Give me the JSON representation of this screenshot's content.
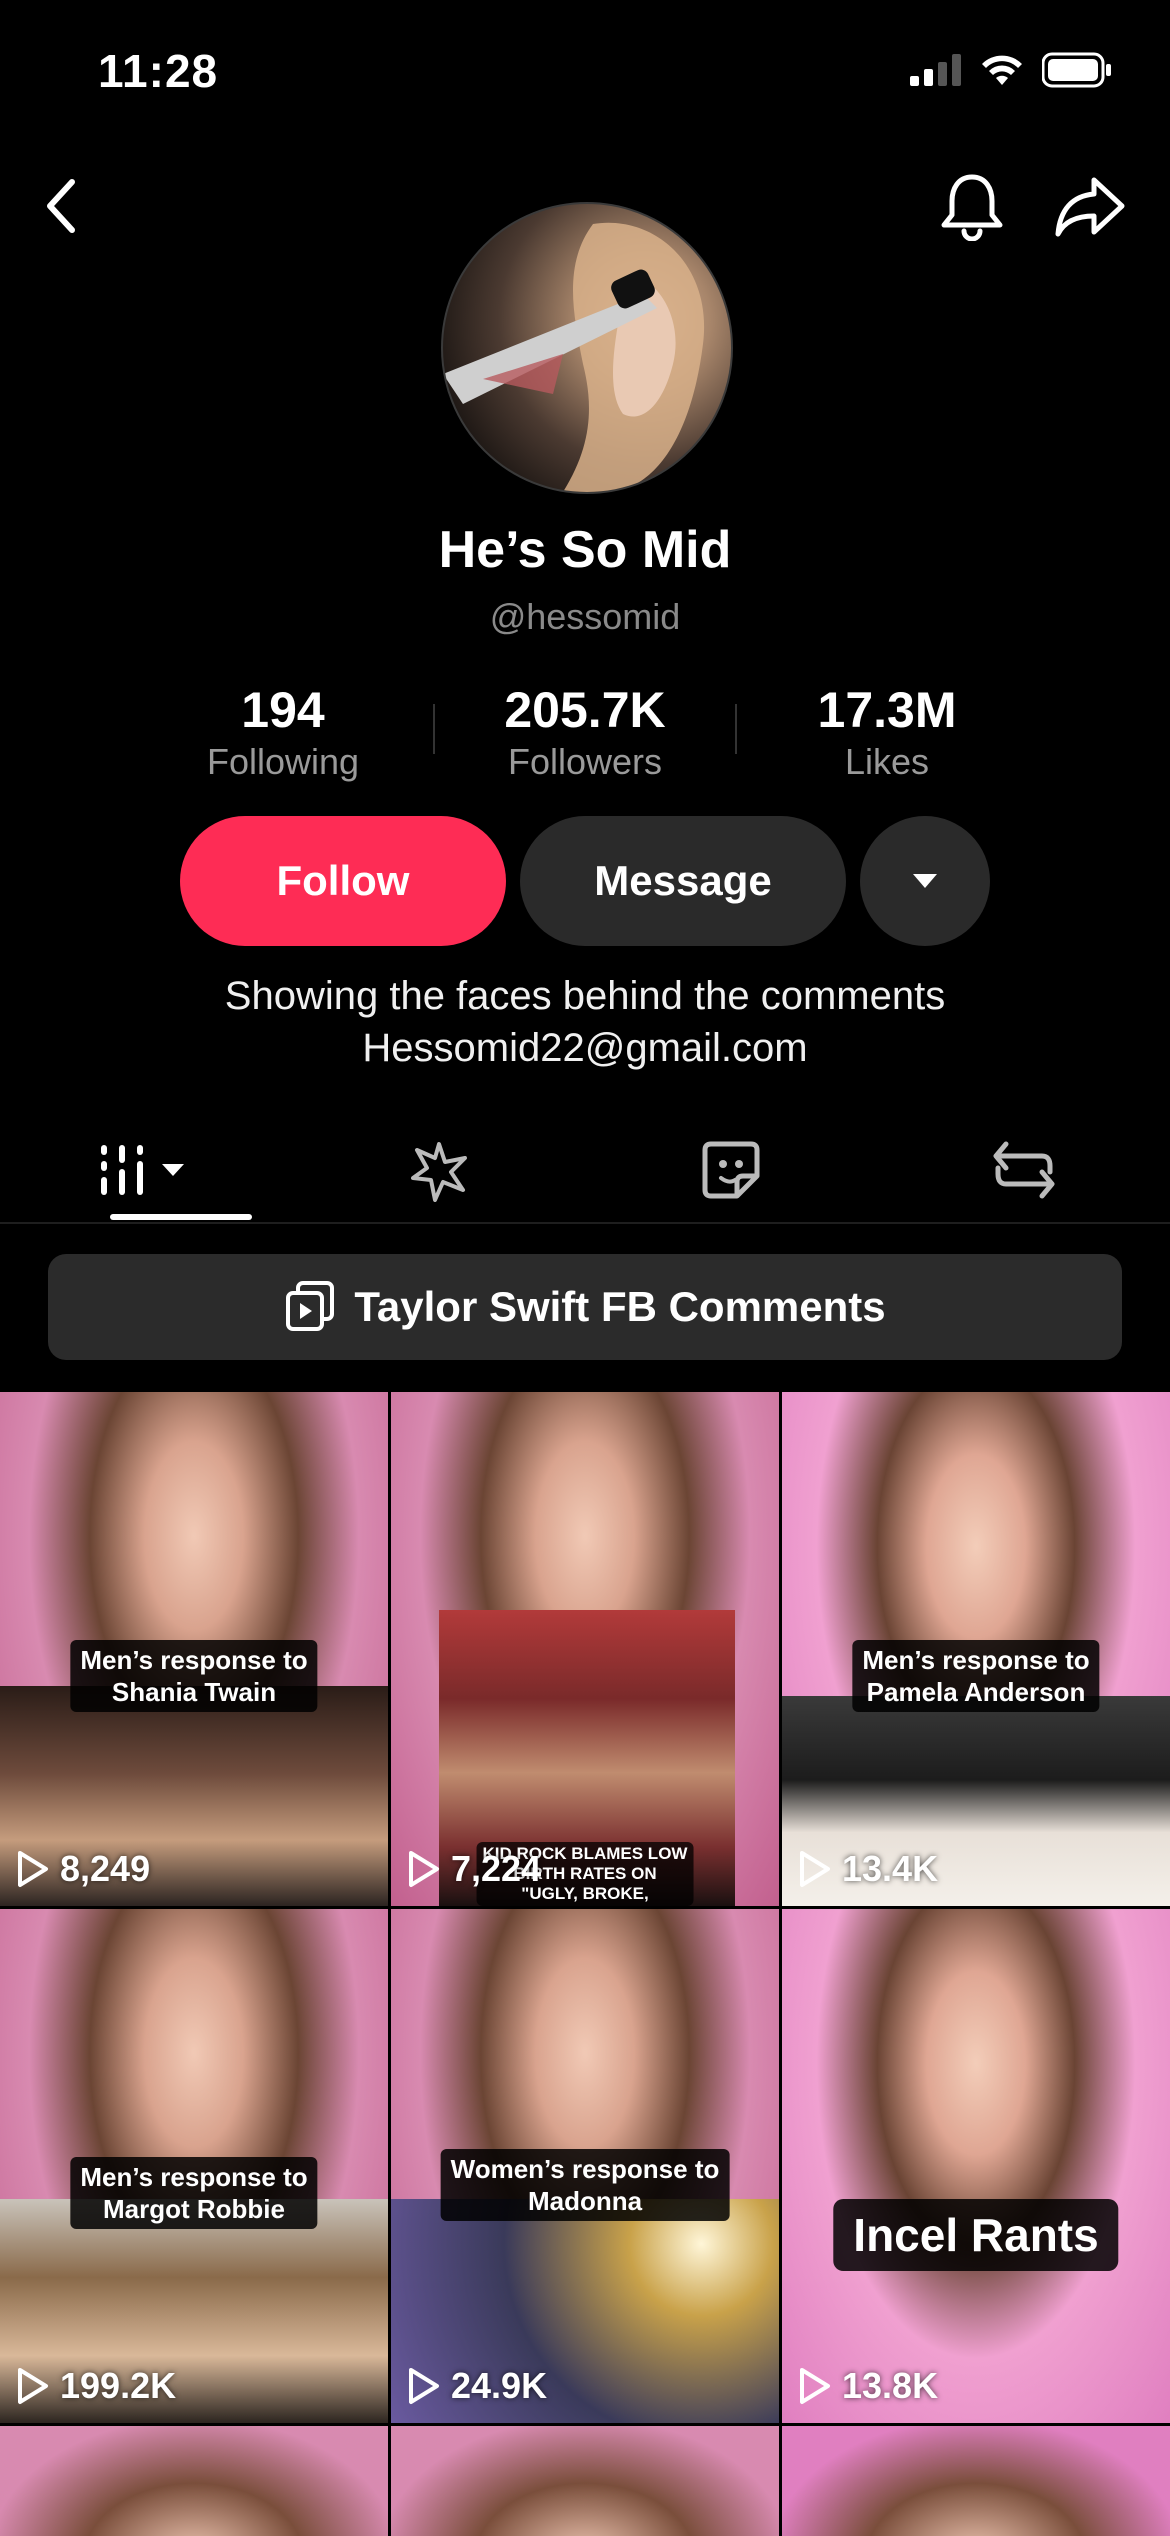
{
  "status_bar": {
    "time": "11:28"
  },
  "profile": {
    "display_name": "He’s So Mid",
    "handle": "@hessomid",
    "stats": {
      "following": {
        "value": "194",
        "label": "Following"
      },
      "followers": {
        "value": "205.7K",
        "label": "Followers"
      },
      "likes": {
        "value": "17.3M",
        "label": "Likes"
      }
    },
    "buttons": {
      "follow": "Follow",
      "message": "Message"
    },
    "bio": [
      "Showing the faces behind the comments",
      "Hessomid22@gmail.com"
    ]
  },
  "tabs": [
    {
      "icon": "videos-grid-icon",
      "active": true
    },
    {
      "icon": "magic-effects-icon",
      "active": false
    },
    {
      "icon": "sticker-icon",
      "active": false
    },
    {
      "icon": "repost-icon",
      "active": false
    }
  ],
  "playlist": {
    "label": "Taylor Swift FB Comments"
  },
  "colors": {
    "follow": "#fe2c55",
    "background": "#000000",
    "button_dark": "#2a2a2a"
  },
  "videos": [
    {
      "caption": "Men’s response to\nShania Twain",
      "views": "8,249"
    },
    {
      "caption": "KID ROCK BLAMES LOW BIRTH RATES ON \"UGLY, BROKE,",
      "views": "7,224"
    },
    {
      "caption": "Men’s response to\nPamela Anderson",
      "views": "13.4K"
    },
    {
      "caption": "Men’s response to\nMargot Robbie",
      "views": "199.2K"
    },
    {
      "caption": "Women’s response to\nMadonna",
      "views": "24.9K"
    },
    {
      "caption": "Incel Rants",
      "views": "13.8K"
    }
  ]
}
